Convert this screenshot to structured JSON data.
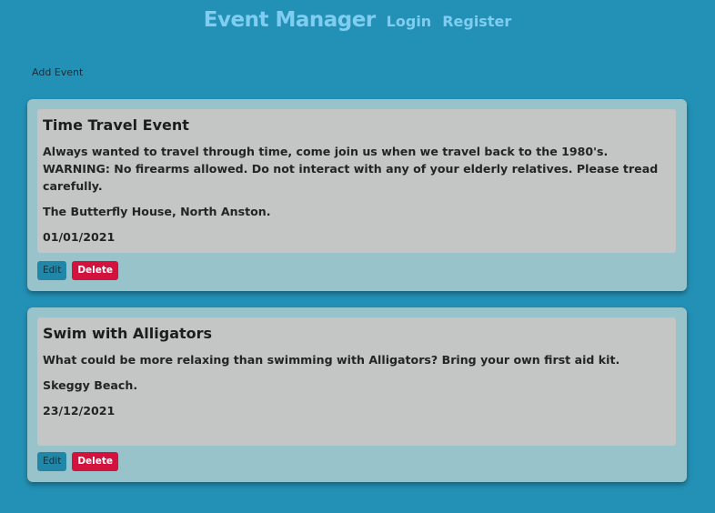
{
  "nav": {
    "brand": "Event Manager",
    "login": "Login",
    "register": "Register"
  },
  "actions": {
    "add_event": "Add Event"
  },
  "events": [
    {
      "title": "Time Travel Event",
      "description": "Always wanted to travel through time, come join us when we travel back to the 1980's. WARNING: No firearms allowed. Do not interact with any of your elderly relatives. Please tread carefully.",
      "location": "The Butterfly House, North Anston.",
      "date": "01/01/2021",
      "edit_label": "Edit",
      "delete_label": "Delete"
    },
    {
      "title": "Swim with Alligators",
      "description": "What could be more relaxing than swimming with Alligators? Bring your own first aid kit.",
      "location": "Skeggy Beach.",
      "date": "23/12/2021",
      "edit_label": "Edit",
      "delete_label": "Delete"
    }
  ],
  "colors": {
    "background": "#2391b6",
    "nav_text": "#7fcdf0",
    "card": "#99c3cb",
    "card_inner": "#c4c6c6",
    "edit_button": "#2187a8",
    "delete_button": "#d4123e"
  }
}
